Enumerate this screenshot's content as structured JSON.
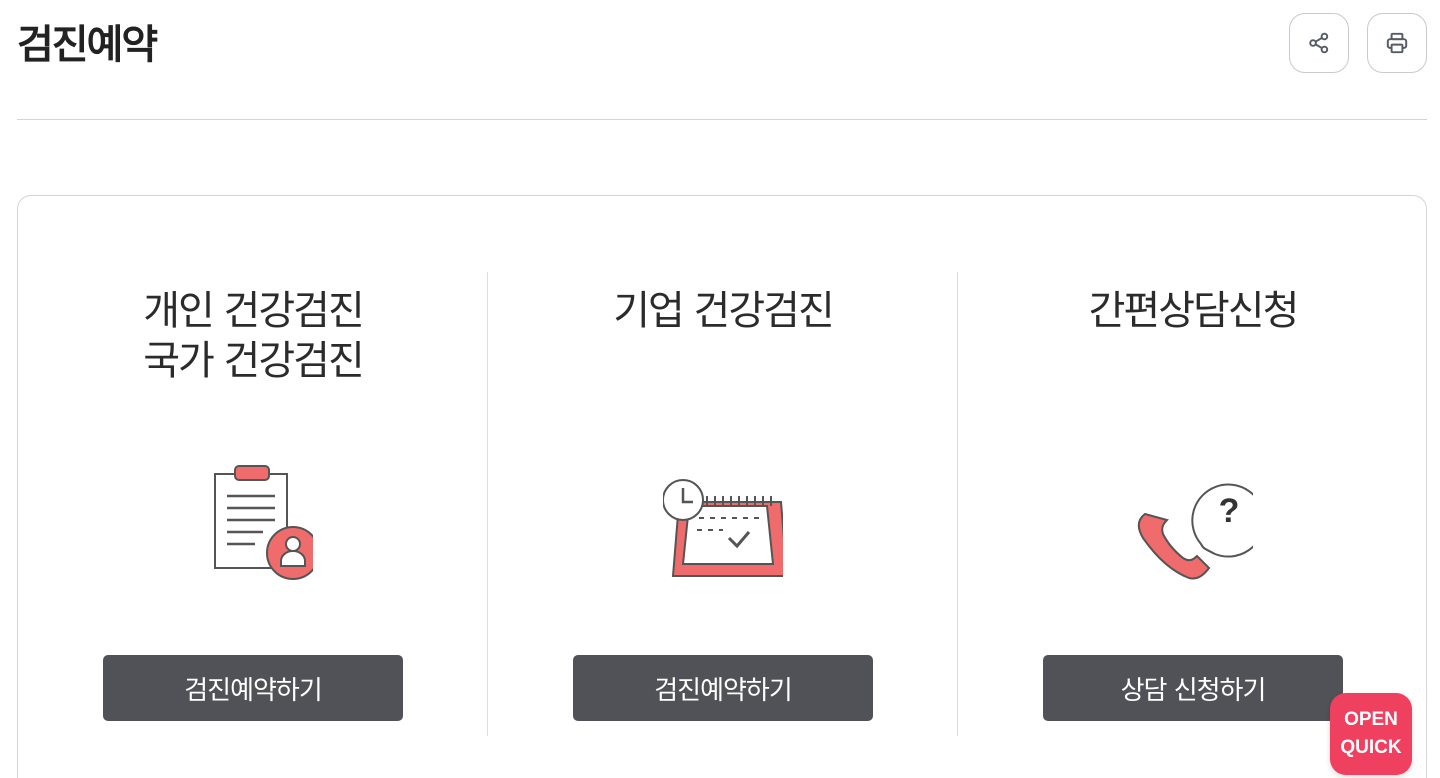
{
  "page": {
    "title": "검진예약"
  },
  "toolbar": {
    "share_icon": "share-icon",
    "print_icon": "print-icon"
  },
  "colors": {
    "accent": "#f06b6b",
    "button_bg": "#505257",
    "quick_bg": "#ef4060",
    "line": "#555555"
  },
  "cards": [
    {
      "title_lines": [
        "개인 건강검진",
        "국가 건강검진"
      ],
      "icon": "clipboard-person-icon",
      "button_label": "검진예약하기"
    },
    {
      "title_lines": [
        "기업 건강검진"
      ],
      "icon": "calendar-clock-icon",
      "button_label": "검진예약하기"
    },
    {
      "title_lines": [
        "간편상담신청"
      ],
      "icon": "phone-question-icon",
      "button_label": "상담 신청하기"
    }
  ],
  "quick_menu": {
    "line1": "OPEN",
    "line2": "QUICK"
  }
}
